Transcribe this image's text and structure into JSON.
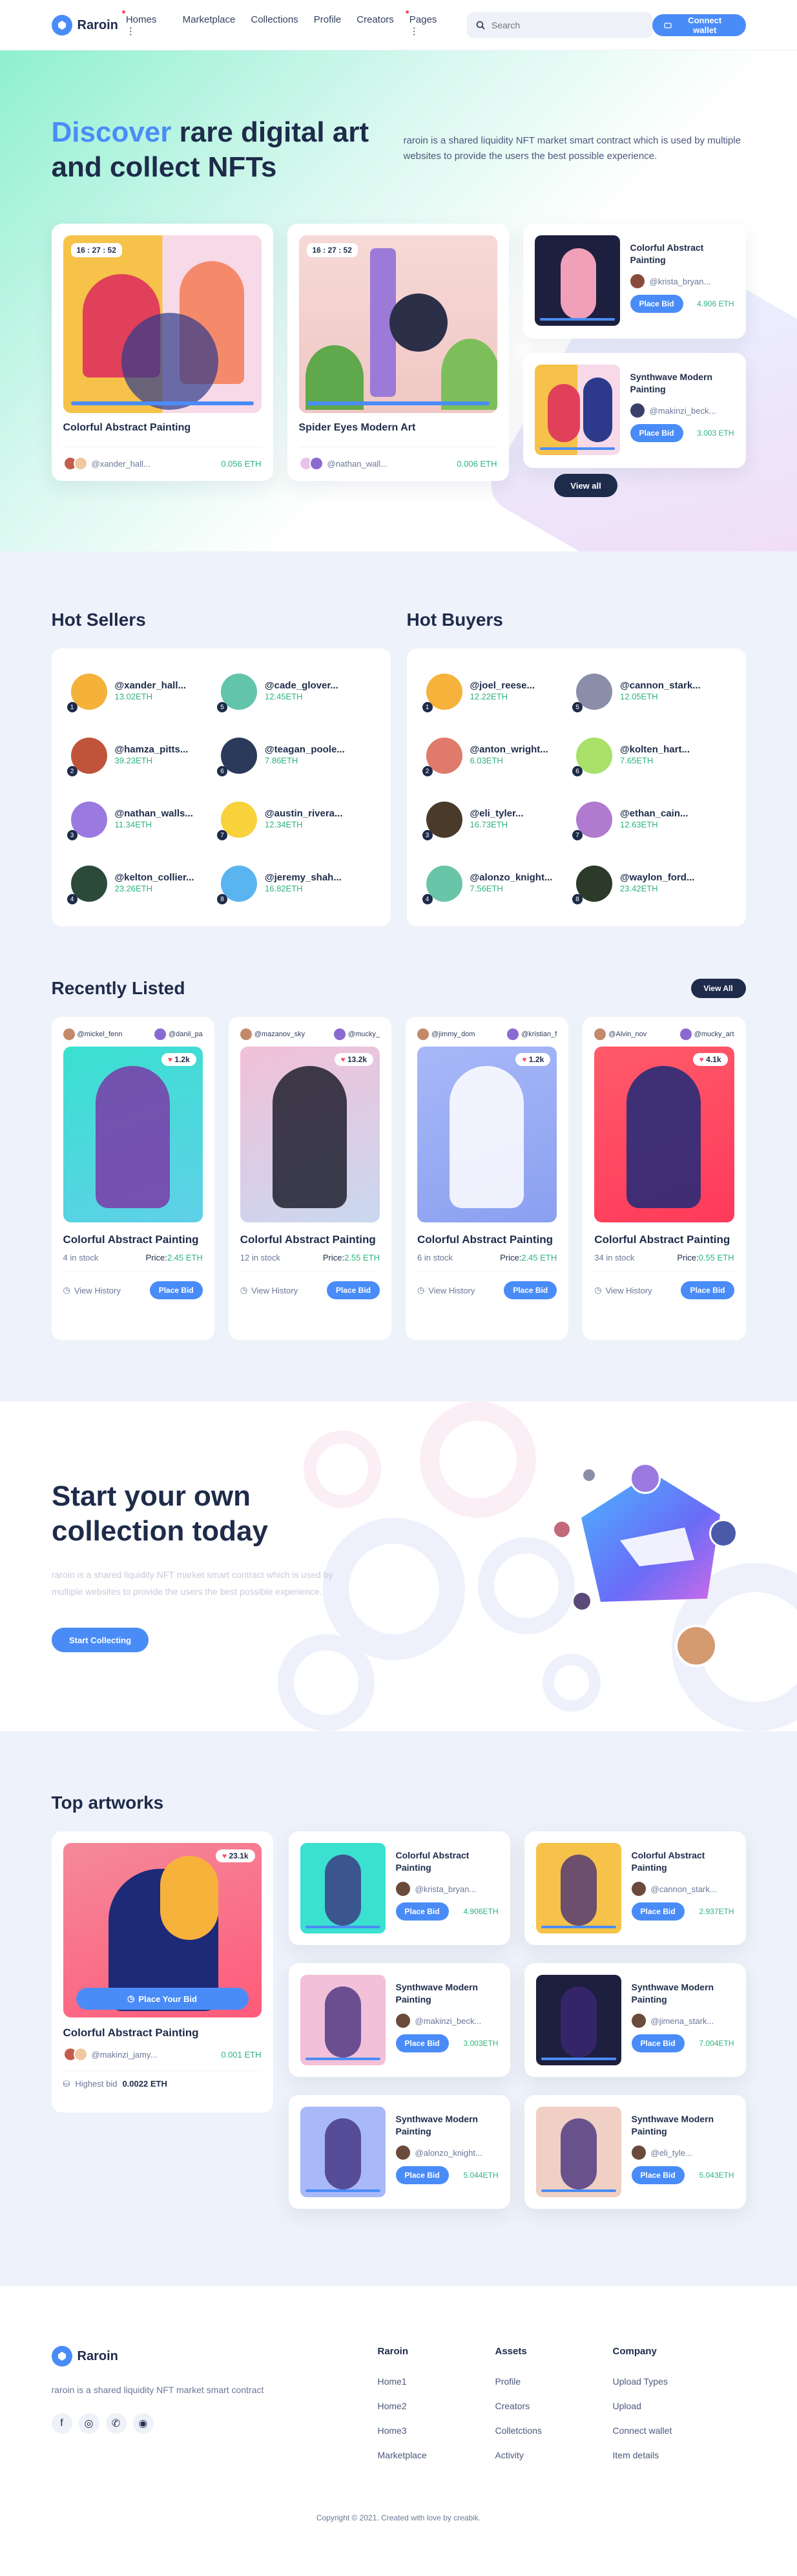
{
  "header": {
    "brand": "Raroin",
    "nav": [
      "Homes",
      "Marketplace",
      "Collections",
      "Profile",
      "Creators",
      "Pages"
    ],
    "search_placeholder": "Search",
    "connect_label": "Connect wallet"
  },
  "hero": {
    "title_accent": "Discover",
    "title_rest": " rare digital art and collect NFTs",
    "description": "raroin is a shared liquidity NFT market smart contract which is used by multiple websites to provide the users the best possible experience.",
    "featured": [
      {
        "timer": "16 : 27 : 52",
        "title": "Colorful Abstract Painting",
        "user": "@xander_hall...",
        "price": "0.056 ETH"
      },
      {
        "timer": "16 : 27 : 52",
        "title": "Spider Eyes Modern Art",
        "user": "@nathan_wall...",
        "price": "0.006 ETH"
      }
    ],
    "side": [
      {
        "title": "Colorful Abstract Painting",
        "user": "@krista_bryan...",
        "bid_label": "Place Bid",
        "price": "4.906 ETH"
      },
      {
        "title": "Synthwave Modern Painting",
        "user": "@makinzi_beck...",
        "bid_label": "Place Bid",
        "price": "3.003 ETH"
      }
    ],
    "view_all": "View all"
  },
  "sellers": {
    "hot_sellers_title": "Hot Sellers",
    "hot_buyers_title": "Hot Buyers",
    "hot_sellers": [
      {
        "rank": "1",
        "name": "@xander_hall...",
        "amount": "13.02ETH"
      },
      {
        "rank": "5",
        "name": "@cade_glover...",
        "amount": "12.45ETH"
      },
      {
        "rank": "2",
        "name": "@hamza_pitts...",
        "amount": "39.23ETH"
      },
      {
        "rank": "6",
        "name": "@teagan_poole...",
        "amount": "7.86ETH"
      },
      {
        "rank": "3",
        "name": "@nathan_walls...",
        "amount": "11.34ETH"
      },
      {
        "rank": "7",
        "name": "@austin_rivera...",
        "amount": "12.34ETH"
      },
      {
        "rank": "4",
        "name": "@kelton_collier...",
        "amount": "23.26ETH"
      },
      {
        "rank": "8",
        "name": "@jeremy_shah...",
        "amount": "16.82ETH"
      }
    ],
    "hot_buyers": [
      {
        "rank": "1",
        "name": "@joel_reese...",
        "amount": "12.22ETH"
      },
      {
        "rank": "5",
        "name": "@cannon_stark...",
        "amount": "12.05ETH"
      },
      {
        "rank": "2",
        "name": "@anton_wright...",
        "amount": "6.03ETH"
      },
      {
        "rank": "6",
        "name": "@kolten_hart...",
        "amount": "7.65ETH"
      },
      {
        "rank": "3",
        "name": "@eli_tyler...",
        "amount": "16.73ETH"
      },
      {
        "rank": "7",
        "name": "@ethan_cain...",
        "amount": "12.63ETH"
      },
      {
        "rank": "4",
        "name": "@alonzo_knight...",
        "amount": "7.56ETH"
      },
      {
        "rank": "8",
        "name": "@waylon_ford...",
        "amount": "23.42ETH"
      }
    ]
  },
  "recent": {
    "title": "Recently Listed",
    "view_all": "View All",
    "items": [
      {
        "c1": "@mickel_fenn",
        "c2": "@danil_pa",
        "likes": "1.2k",
        "title": "Colorful Abstract Painting",
        "stock": "4 in stock",
        "price_label": "Price:",
        "price": "2.45 ETH",
        "history": "View History",
        "bid": "Place Bid"
      },
      {
        "c1": "@mazanov_sky",
        "c2": "@mucky_",
        "likes": "13.2k",
        "title": "Colorful Abstract Painting",
        "stock": "12 in stock",
        "price_label": "Price:",
        "price": "2.55 ETH",
        "history": "View History",
        "bid": "Place Bid"
      },
      {
        "c1": "@jimmy_dom",
        "c2": "@kristian_f",
        "likes": "1.2k",
        "title": "Colorful Abstract Painting",
        "stock": "6 in stock",
        "price_label": "Price:",
        "price": "2.45 ETH",
        "history": "View History",
        "bid": "Place Bid"
      },
      {
        "c1": "@Alvin_nov",
        "c2": "@mucky_art",
        "likes": "4.1k",
        "title": "Colorful Abstract Painting",
        "stock": "34 in stock",
        "price_label": "Price:",
        "price": "0.55 ETH",
        "history": "View History",
        "bid": "Place Bid"
      }
    ]
  },
  "start": {
    "title": "Start your own collection today",
    "description": "raroin is a shared liquidity NFT market smart contract which is used by multiple websites to provide the users the best possible experience.",
    "button": "Start Collecting"
  },
  "top": {
    "title": "Top artworks",
    "big": {
      "likes": "23.1k",
      "place_bid": "Place Your Bid",
      "title": "Colorful Abstract Painting",
      "user": "@makinzi_jamy...",
      "price": "0.001 ETH",
      "highest_label": "Highest bid",
      "highest_value": "0.0022 ETH"
    },
    "items": [
      {
        "title": "Colorful Abstract Painting",
        "user": "@krista_bryan...",
        "bid": "Place Bid",
        "price": "4.906ETH"
      },
      {
        "title": "Colorful Abstract Painting",
        "user": "@cannon_stark...",
        "bid": "Place Bid",
        "price": "2.937ETH"
      },
      {
        "title": "Synthwave Modern Painting",
        "user": "@makinzi_beck...",
        "bid": "Place Bid",
        "price": "3.003ETH"
      },
      {
        "title": "Synthwave Modern Painting",
        "user": "@jimena_stark...",
        "bid": "Place Bid",
        "price": "7.004ETH"
      },
      {
        "title": "Synthwave Modern Painting",
        "user": "@alonzo_knight...",
        "bid": "Place Bid",
        "price": "5.044ETH"
      },
      {
        "title": "Synthwave Modern Painting",
        "user": "@eli_tyle...",
        "bid": "Place Bid",
        "price": "5.043ETH"
      }
    ]
  },
  "footer": {
    "brand": "Raroin",
    "tagline": "raroin is a shared liquidity NFT market smart contract",
    "social_icons": [
      "facebook-icon",
      "messenger-icon",
      "whatsapp-icon",
      "discord-icon"
    ],
    "columns": [
      {
        "title": "Raroin",
        "links": [
          "Home1",
          "Home2",
          "Home3",
          "Marketplace"
        ]
      },
      {
        "title": "Assets",
        "links": [
          "Profile",
          "Creators",
          "Colletctions",
          "Activity"
        ]
      },
      {
        "title": "Company",
        "links": [
          "Upload Types",
          "Upload",
          "Connect wallet",
          "Item details"
        ]
      }
    ],
    "copyright": "Copyright © 2021. Created with love by creabik."
  },
  "colors": {
    "accent": "#4a8cf7",
    "dark": "#1e2b4a",
    "eth": "#2db37c",
    "like": "#ff4d6d"
  }
}
